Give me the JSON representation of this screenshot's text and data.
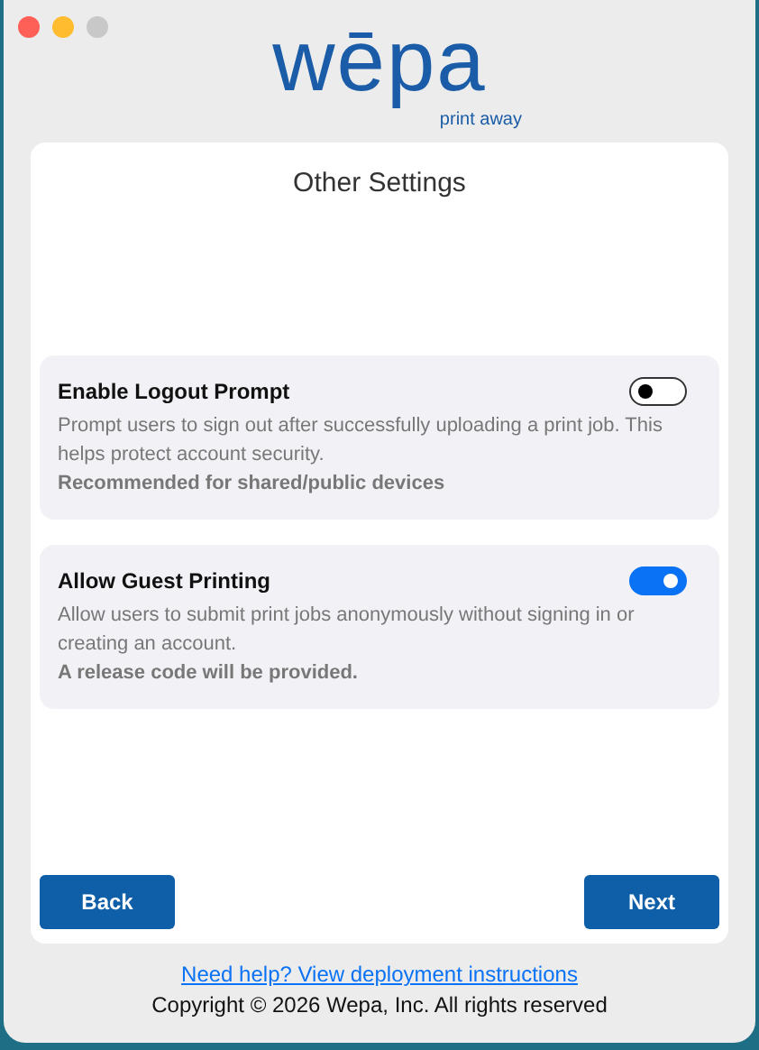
{
  "window": {
    "controls": [
      {
        "kind": "close"
      },
      {
        "kind": "minimize"
      },
      {
        "kind": "zoom"
      }
    ]
  },
  "logo": {
    "name": "wēpa",
    "tagline": "print away"
  },
  "title": "Other Settings",
  "settings": [
    {
      "label": "Enable Logout Prompt",
      "on": false,
      "description": "Prompt users to sign out after successfully uploading a print job. This helps protect account security.",
      "note": "Recommended for shared/public devices"
    },
    {
      "label": "Allow Guest Printing",
      "on": true,
      "description": "Allow users to submit print jobs anonymously without signing in or creating an account.",
      "note": "A release code will be provided."
    }
  ],
  "buttons": {
    "back": "Back",
    "next": "Next"
  },
  "help_link": "Need help? View deployment instructions",
  "copyright": "Copyright © 2026 Wepa, Inc. All rights reserved"
}
